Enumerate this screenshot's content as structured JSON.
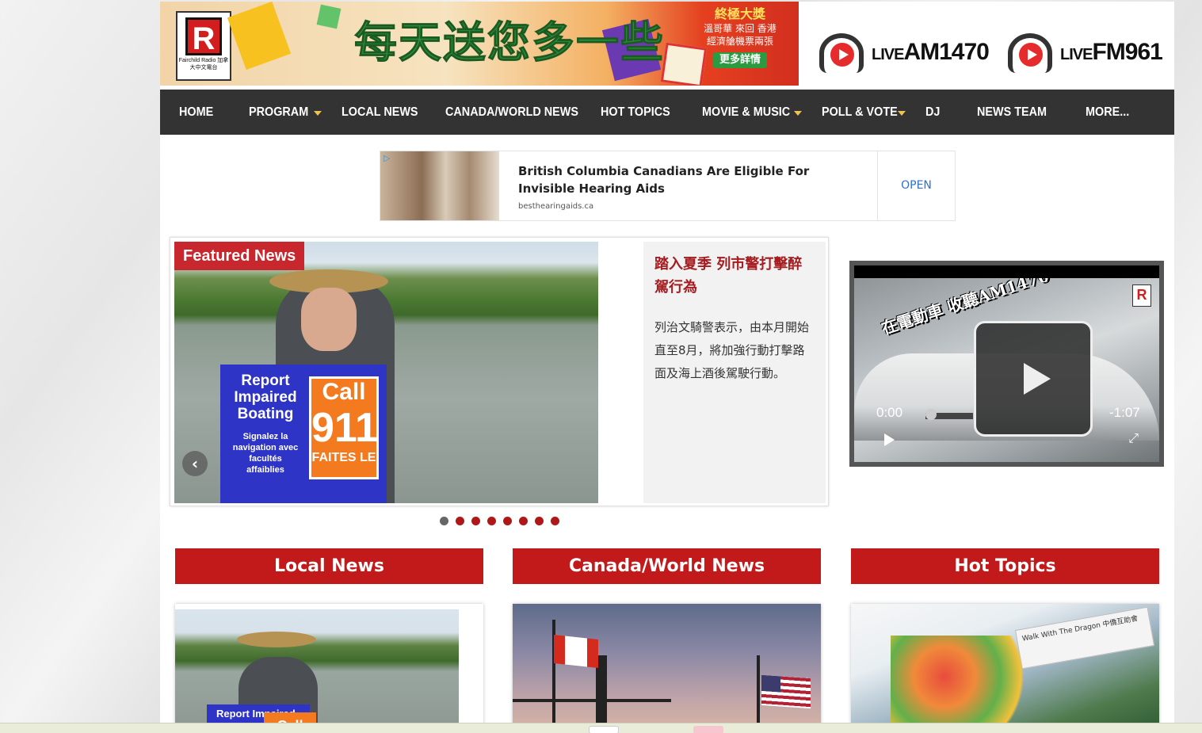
{
  "banner": {
    "logo_letter": "R",
    "logo_text": "Fairchild Radio 加拿大中文電台",
    "slogan": "每天送您多一些",
    "prize_title": "終極大獎",
    "prize_line1": "溫哥華 來回 香港",
    "prize_line2": "經濟艙機票兩張",
    "prize_more": "更多詳情"
  },
  "live": [
    {
      "prefix": "LIVE",
      "station": "AM1470"
    },
    {
      "prefix": "LIVE",
      "station": "FM961"
    }
  ],
  "nav": {
    "items": [
      "HOME",
      "PROGRAM",
      "LOCAL NEWS",
      "CANADA/WORLD NEWS",
      "HOT TOPICS",
      "MOVIE & MUSIC",
      "POLL & VOTE",
      "DJ",
      "NEWS TEAM",
      "MORE..."
    ]
  },
  "ad": {
    "badge": "▷",
    "title": "British Columbia Canadians Are Eligible For Invisible Hearing Aids",
    "domain": "besthearingaids.ca",
    "cta": "OPEN"
  },
  "featured": {
    "tag": "Featured News",
    "sign_blue_title": "Report Impaired Boating",
    "sign_blue_sub": "Signalez la navigation avec facultés affaiblies",
    "sign_orange_call": "Call",
    "sign_orange_number": "911",
    "sign_orange_fr": "FAITES LE",
    "headline": "踏入夏季 列市警打擊醉駕行為",
    "body": "列治文騎警表示，由本月開始直至8月，將加強行動打擊路面及海上酒後駕駛行動。",
    "prev": "‹",
    "next": "›",
    "slide_count": 8,
    "active_slide": 1
  },
  "video": {
    "caption": "在電動車 收聽AM1470",
    "logo": "R",
    "time_current": "0:00",
    "time_remaining": "-1:07",
    "fullscreen": "⤢"
  },
  "sections": [
    {
      "title": "Local News"
    },
    {
      "title": "Canada/World News"
    },
    {
      "title": "Hot Topics"
    }
  ],
  "cards": {
    "local_sign_blue": "Report Impaired",
    "local_sign_orange": "Call",
    "hot_banner": "Walk With The Dragon 中僑互助會"
  },
  "colors": {
    "nav_bg": "#333333",
    "accent_red": "#c21a1a",
    "headline_red": "#a51d20",
    "caret": "#f0c44c"
  }
}
